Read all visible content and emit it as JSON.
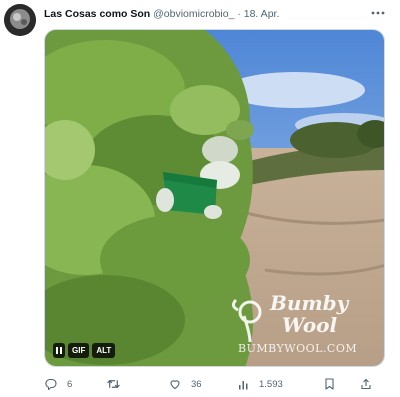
{
  "tweet": {
    "display_name": "Las Cosas como Son",
    "handle": "@obviomicrobio_",
    "separator": "·",
    "date": "18. Apr."
  },
  "media": {
    "controls": {
      "gif_label": "GIF",
      "alt_label": "ALT"
    },
    "watermark": {
      "line1": "Bumby",
      "line2": "Wool",
      "url": "BUMBYWOOL.COM"
    }
  },
  "actions": {
    "replies": "6",
    "retweets": "",
    "likes": "36",
    "views": "1.593"
  },
  "icons": {
    "more": "more-dots-icon",
    "reply": "reply-icon",
    "retweet": "retweet-icon",
    "like": "heart-icon",
    "views": "views-chart-icon",
    "bookmark": "bookmark-icon",
    "share": "share-icon"
  },
  "colors": {
    "text": "#0f1419",
    "secondary": "#536471",
    "border": "#cfd9de"
  }
}
